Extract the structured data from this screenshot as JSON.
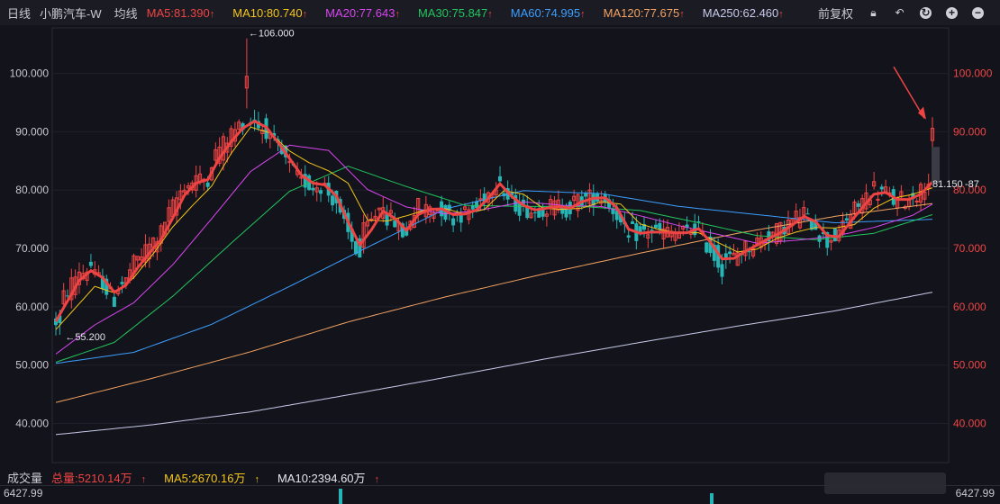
{
  "header": {
    "period": "日线",
    "stock_name": "小鹏汽车-W",
    "ma_label": "均线",
    "ma_items": [
      {
        "label": "MA5:81.390",
        "color": "#ef4444"
      },
      {
        "label": "MA10:80.740",
        "color": "#f5c518"
      },
      {
        "label": "MA20:77.643",
        "color": "#d946ef"
      },
      {
        "label": "MA30:75.847",
        "color": "#22c55e"
      },
      {
        "label": "MA60:74.995",
        "color": "#3b9eff"
      },
      {
        "label": "MA120:77.675",
        "color": "#f4a261"
      },
      {
        "label": "MA250:62.460",
        "color": "#c7c9ea"
      }
    ],
    "up_arrow": "↑",
    "adjust_label": "前复权",
    "icons": [
      "lock-icon",
      "undo-icon",
      "refresh-icon",
      "zoom-in-icon",
      "zoom-out-icon"
    ]
  },
  "chart_data": {
    "type": "candlestick",
    "y_ticks": [
      "100.000",
      "90.000",
      "80.000",
      "70.000",
      "60.000",
      "50.000",
      "40.000"
    ],
    "ylim": [
      33.3,
      107.8
    ],
    "high_label": "←106.000",
    "low_label": "←55.200",
    "last_price_label": "81.150",
    "overlap_label": "-87",
    "colors": {
      "up": "#ef4444",
      "down": "#26b5b5",
      "ma5": "#ef4444",
      "ma10": "#f5c518",
      "ma20": "#d946ef",
      "ma30": "#22c55e",
      "ma60": "#3b9eff",
      "ma120": "#f4a261",
      "ma250": "#c7c9ea"
    },
    "ma5": [
      [
        0,
        57.5
      ],
      [
        3,
        61
      ],
      [
        6,
        64.5
      ],
      [
        9,
        66.2
      ],
      [
        12,
        65
      ],
      [
        15,
        62.5
      ],
      [
        18,
        63.7
      ],
      [
        21,
        66.7
      ],
      [
        24,
        69.2
      ],
      [
        27,
        71.5
      ],
      [
        30,
        75.2
      ],
      [
        33,
        79.1
      ],
      [
        36,
        81.2
      ],
      [
        39,
        81.8
      ],
      [
        42,
        85.5
      ],
      [
        45,
        88.3
      ],
      [
        48,
        90.6
      ],
      [
        51,
        91.8
      ],
      [
        54,
        90.8
      ],
      [
        57,
        88.2
      ],
      [
        60,
        85.4
      ],
      [
        63,
        82.6
      ],
      [
        66,
        81.2
      ],
      [
        69,
        80.9
      ],
      [
        72,
        79
      ],
      [
        75,
        74.6
      ],
      [
        78,
        70.6
      ],
      [
        81,
        73.2
      ],
      [
        84,
        76.4
      ],
      [
        87,
        75.2
      ],
      [
        90,
        73.1
      ],
      [
        93,
        75.8
      ],
      [
        96,
        76.7
      ],
      [
        99,
        76.8
      ],
      [
        102,
        75.8
      ],
      [
        105,
        75.9
      ],
      [
        108,
        76.6
      ],
      [
        111,
        78.6
      ],
      [
        114,
        81.1
      ],
      [
        117,
        78.9
      ],
      [
        120,
        77.4
      ],
      [
        123,
        76.6
      ],
      [
        126,
        76.9
      ],
      [
        129,
        77.2
      ],
      [
        132,
        76.9
      ],
      [
        135,
        78
      ],
      [
        138,
        78.6
      ],
      [
        141,
        78.7
      ],
      [
        144,
        77
      ],
      [
        147,
        73.3
      ],
      [
        150,
        72.6
      ],
      [
        153,
        72.8
      ],
      [
        156,
        72.8
      ],
      [
        159,
        72.7
      ],
      [
        162,
        72.7
      ],
      [
        165,
        73.4
      ],
      [
        168,
        71.1
      ],
      [
        171,
        68.2
      ],
      [
        174,
        68.3
      ],
      [
        177,
        69.5
      ],
      [
        180,
        70.6
      ],
      [
        183,
        71.7
      ],
      [
        186,
        72.7
      ],
      [
        189,
        74
      ],
      [
        192,
        75.5
      ],
      [
        195,
        74.6
      ],
      [
        198,
        72.2
      ],
      [
        201,
        72
      ],
      [
        204,
        74.6
      ],
      [
        207,
        77
      ],
      [
        210,
        79.3
      ],
      [
        213,
        79.6
      ],
      [
        216,
        78.4
      ],
      [
        219,
        78.4
      ],
      [
        222,
        79.3
      ],
      [
        225,
        81.4
      ]
    ],
    "ma10": [
      [
        0,
        56.1
      ],
      [
        5,
        59.8
      ],
      [
        10,
        63.5
      ],
      [
        15,
        62.4
      ],
      [
        20,
        65
      ],
      [
        25,
        69.1
      ],
      [
        30,
        73.7
      ],
      [
        35,
        77.3
      ],
      [
        40,
        80.7
      ],
      [
        45,
        86.3
      ],
      [
        50,
        90.8
      ],
      [
        55,
        89.8
      ],
      [
        60,
        86.7
      ],
      [
        65,
        84.7
      ],
      [
        70,
        83.3
      ],
      [
        75,
        81.2
      ],
      [
        80,
        74.9
      ],
      [
        85,
        74.7
      ],
      [
        90,
        75.6
      ],
      [
        95,
        76.6
      ],
      [
        100,
        76.8
      ],
      [
        105,
        75.9
      ],
      [
        110,
        76.7
      ],
      [
        115,
        79.9
      ],
      [
        120,
        79.3
      ],
      [
        125,
        76.9
      ],
      [
        130,
        76.7
      ],
      [
        135,
        76.9
      ],
      [
        140,
        78
      ],
      [
        145,
        77.6
      ],
      [
        150,
        74.2
      ],
      [
        155,
        73.2
      ],
      [
        160,
        72.7
      ],
      [
        165,
        72.7
      ],
      [
        170,
        71
      ],
      [
        175,
        69.4
      ],
      [
        180,
        69.9
      ],
      [
        185,
        71.7
      ],
      [
        190,
        72.8
      ],
      [
        195,
        73.6
      ],
      [
        200,
        73.5
      ],
      [
        205,
        74.1
      ],
      [
        210,
        76.9
      ],
      [
        215,
        78.6
      ],
      [
        220,
        79.3
      ],
      [
        225,
        80.4
      ]
    ],
    "ma20": [
      [
        0,
        51.9
      ],
      [
        10,
        56.9
      ],
      [
        20,
        60.7
      ],
      [
        30,
        67.2
      ],
      [
        40,
        75.1
      ],
      [
        50,
        83.2
      ],
      [
        60,
        87.7
      ],
      [
        70,
        86.8
      ],
      [
        80,
        80.1
      ],
      [
        90,
        77.1
      ],
      [
        100,
        75.9
      ],
      [
        110,
        76.7
      ],
      [
        120,
        78
      ],
      [
        130,
        77.4
      ],
      [
        140,
        77.2
      ],
      [
        150,
        75.6
      ],
      [
        160,
        73.9
      ],
      [
        170,
        72.4
      ],
      [
        180,
        70.9
      ],
      [
        190,
        71.4
      ],
      [
        200,
        72.1
      ],
      [
        210,
        73.6
      ],
      [
        220,
        75.7
      ],
      [
        225,
        77.6
      ]
    ],
    "ma30": [
      [
        0,
        50.5
      ],
      [
        15,
        53.9
      ],
      [
        30,
        61.8
      ],
      [
        45,
        70.9
      ],
      [
        60,
        79.8
      ],
      [
        75,
        84.1
      ],
      [
        90,
        80.6
      ],
      [
        105,
        77.4
      ],
      [
        120,
        77.2
      ],
      [
        135,
        77.2
      ],
      [
        150,
        76.5
      ],
      [
        165,
        74.4
      ],
      [
        180,
        72.2
      ],
      [
        195,
        71.5
      ],
      [
        210,
        72.6
      ],
      [
        225,
        75.8
      ]
    ],
    "ma60": [
      [
        0,
        50.3
      ],
      [
        20,
        52.2
      ],
      [
        40,
        57
      ],
      [
        60,
        63.5
      ],
      [
        80,
        70.2
      ],
      [
        100,
        76.8
      ],
      [
        120,
        79.9
      ],
      [
        140,
        79.4
      ],
      [
        160,
        77.2
      ],
      [
        180,
        75.8
      ],
      [
        200,
        74.4
      ],
      [
        225,
        75
      ]
    ],
    "ma120": [
      [
        0,
        43.6
      ],
      [
        25,
        47.8
      ],
      [
        50,
        52.3
      ],
      [
        75,
        57.4
      ],
      [
        100,
        61.7
      ],
      [
        125,
        65.6
      ],
      [
        150,
        69.2
      ],
      [
        175,
        72.6
      ],
      [
        200,
        75.5
      ],
      [
        225,
        77.7
      ]
    ],
    "ma250": [
      [
        0,
        38.1
      ],
      [
        25,
        39.8
      ],
      [
        50,
        42
      ],
      [
        75,
        44.9
      ],
      [
        100,
        47.9
      ],
      [
        125,
        51
      ],
      [
        150,
        53.9
      ],
      [
        175,
        56.7
      ],
      [
        200,
        59.3
      ],
      [
        225,
        62.5
      ]
    ],
    "candles_ohlc_seed": {
      "count": 226,
      "last": {
        "o": 88.5,
        "h": 92.5,
        "l": 87.4,
        "c": 90.6
      }
    }
  },
  "volume": {
    "title": "成交量",
    "total": "总量:5210.14万",
    "ma5": "MA5:2670.16万",
    "ma10": "MA10:2394.60万",
    "axis_left": "6427.99",
    "axis_right": "6427.99"
  }
}
